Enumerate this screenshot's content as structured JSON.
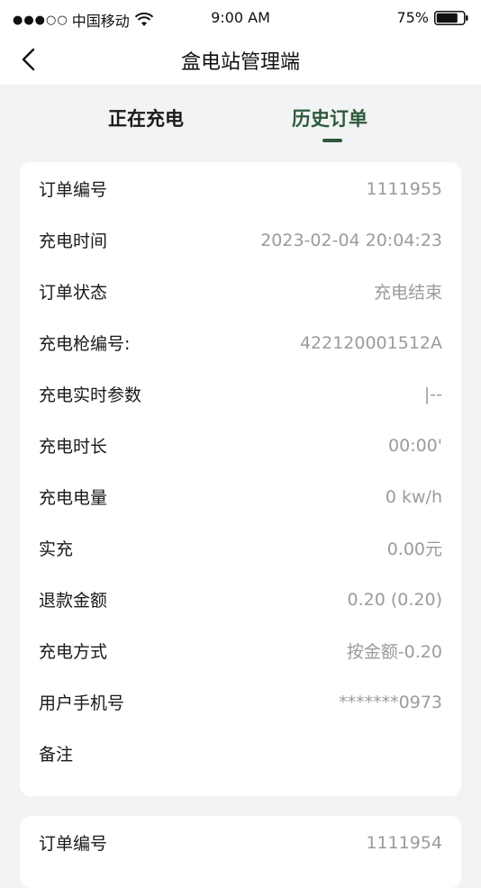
{
  "status_bar": {
    "signal": "●●●○○",
    "carrier": "中国移动",
    "time": "9:00 AM",
    "battery": "75%"
  },
  "nav": {
    "title": "盒电站管理端"
  },
  "tabs": {
    "charging": "正在充电",
    "history": "历史订单",
    "active": "history"
  },
  "orders": [
    {
      "rows": [
        {
          "label": "订单编号",
          "value": "1111955"
        },
        {
          "label": "充电时间",
          "value": "2023-02-04 20:04:23"
        },
        {
          "label": "订单状态",
          "value": "充电结束"
        },
        {
          "label": "充电枪编号:",
          "value": "422120001512A"
        },
        {
          "label": "充电实时参数",
          "value": "|--"
        },
        {
          "label": "充电时长",
          "value": "00:00'"
        },
        {
          "label": "充电电量",
          "value": "0 kw/h"
        },
        {
          "label": "实充",
          "value": "0.00元"
        },
        {
          "label": "退款金额",
          "value": "0.20 (0.20)"
        },
        {
          "label": "充电方式",
          "value": "按金额-0.20"
        },
        {
          "label": "用户手机号",
          "value": "*******0973"
        },
        {
          "label": "备注",
          "value": ""
        }
      ]
    },
    {
      "rows": [
        {
          "label": "订单编号",
          "value": "1111954"
        }
      ]
    }
  ],
  "colors": {
    "accent": "#2e5a3a",
    "background": "#f2f3f5",
    "value_text": "#9b9b9b"
  }
}
